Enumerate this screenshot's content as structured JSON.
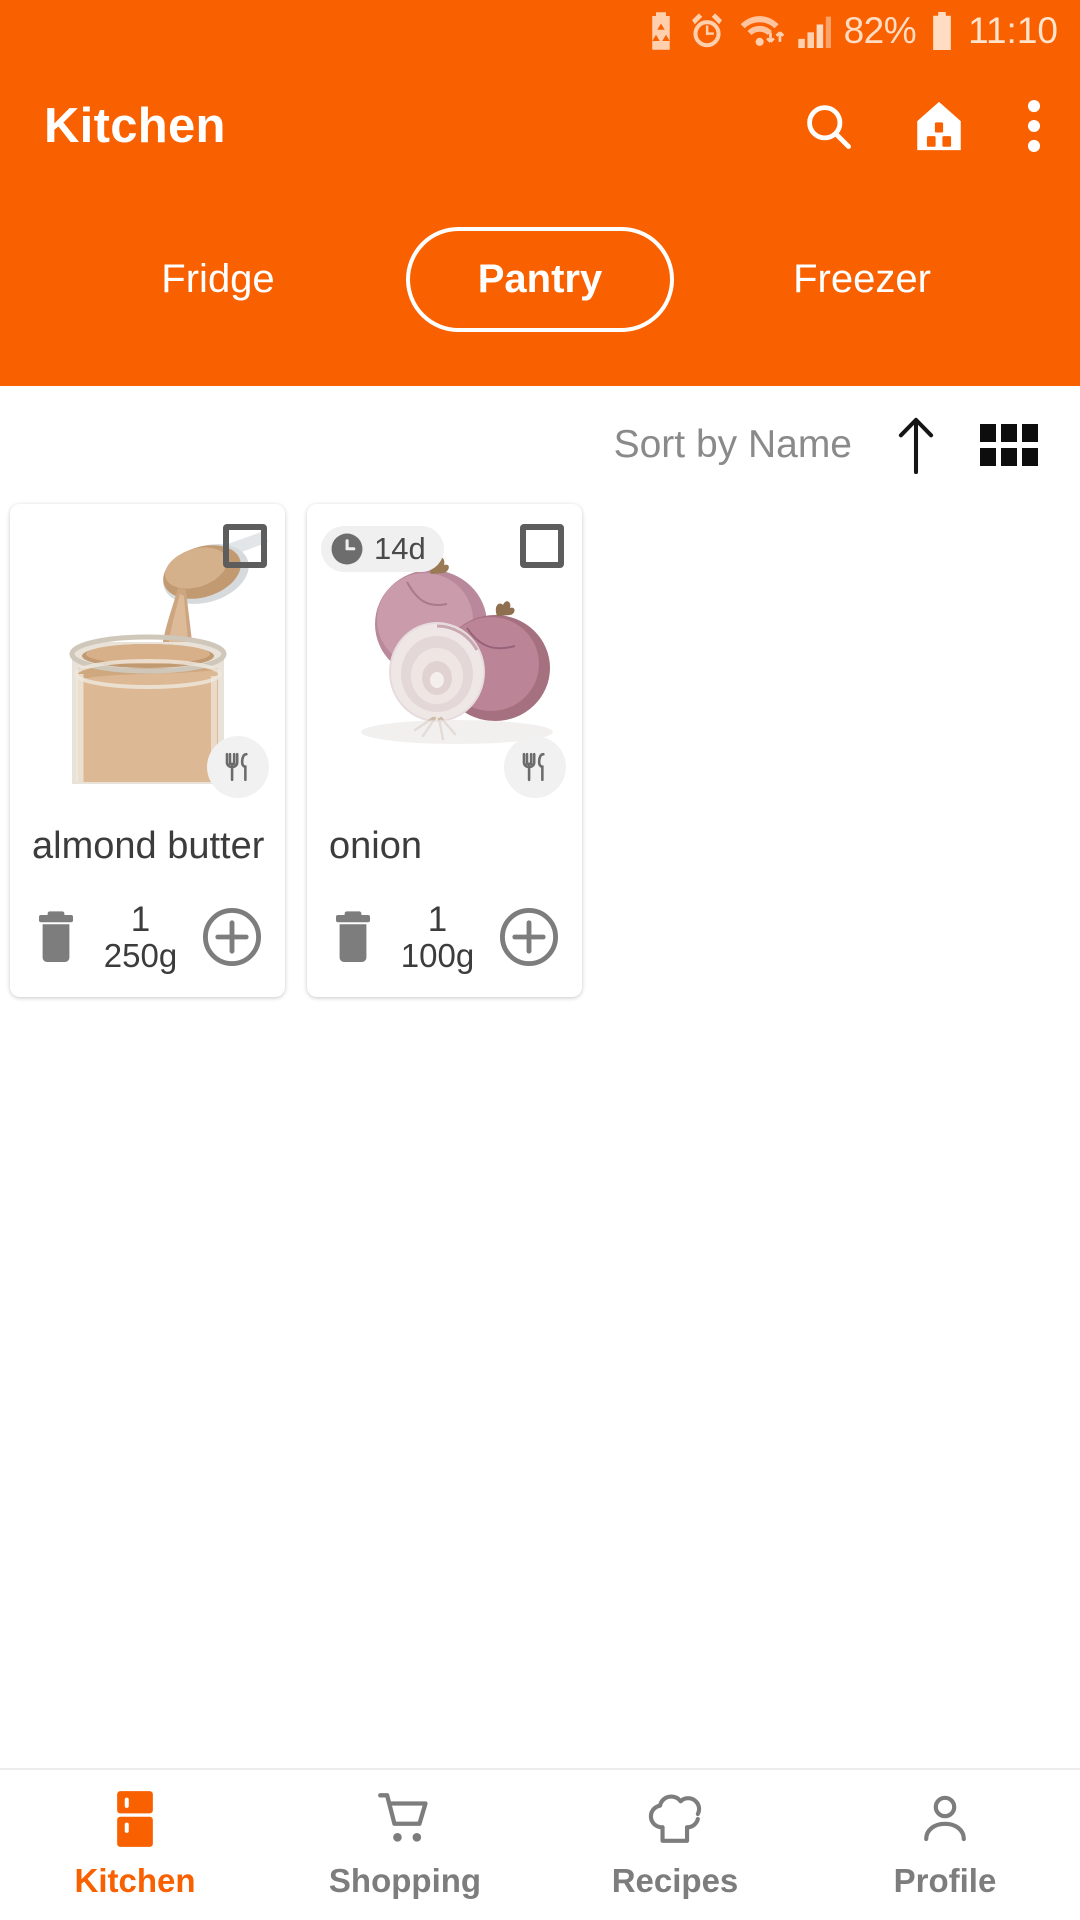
{
  "statusbar": {
    "icons": [
      "battery-saver-icon",
      "alarm-icon",
      "wifi-icon",
      "signal-icon"
    ],
    "battery_percent": "82%",
    "battery_icon": "battery-icon",
    "clock": "11:10"
  },
  "appbar": {
    "title": "Kitchen",
    "actions": [
      {
        "name": "search-icon"
      },
      {
        "name": "home-icon"
      },
      {
        "name": "overflow-menu-icon"
      }
    ]
  },
  "tabs": [
    {
      "label": "Fridge",
      "active": false
    },
    {
      "label": "Pantry",
      "active": true
    },
    {
      "label": "Freezer",
      "active": false
    }
  ],
  "sortbar": {
    "sort_label": "Sort by Name",
    "sort_direction_icon": "arrow-up-icon",
    "view_toggle_icon": "grid-view-icon"
  },
  "items": [
    {
      "name": "almond butter",
      "quantity": "1",
      "unit": "250g",
      "expiry": null,
      "checked": false,
      "image": "almond-butter-jar"
    },
    {
      "name": "onion",
      "quantity": "1",
      "unit": "100g",
      "expiry": "14d",
      "checked": false,
      "image": "onions"
    }
  ],
  "bottomnav": [
    {
      "label": "Kitchen",
      "icon": "fridge-icon",
      "active": true
    },
    {
      "label": "Shopping",
      "icon": "cart-icon",
      "active": false
    },
    {
      "label": "Recipes",
      "icon": "chef-hat-icon",
      "active": false
    },
    {
      "label": "Profile",
      "icon": "person-icon",
      "active": false
    }
  ],
  "colors": {
    "brand_orange": "#F96000",
    "status_icon": "#ffdcc2",
    "muted_text": "#8a8a8a"
  }
}
